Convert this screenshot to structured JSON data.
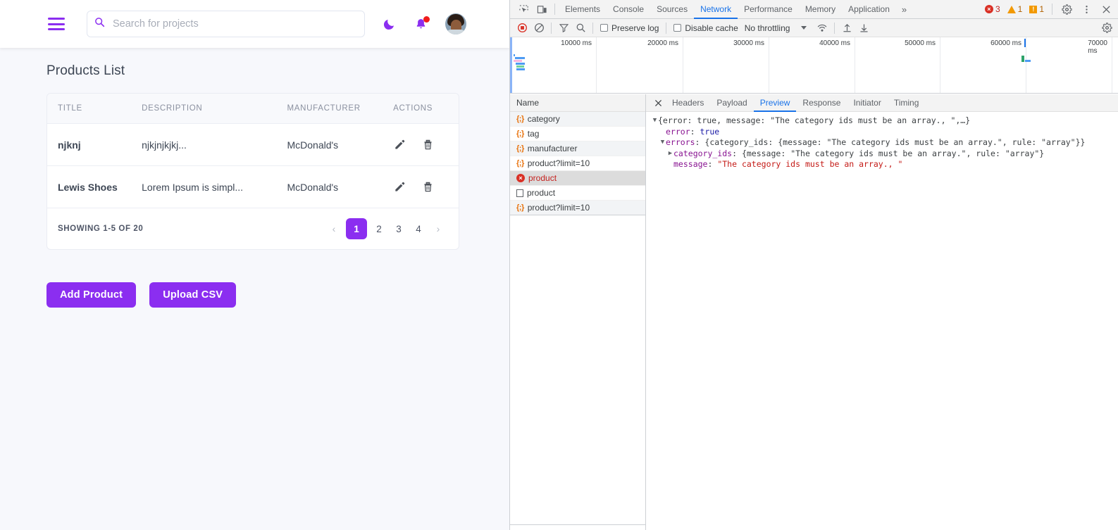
{
  "page": {
    "header": {
      "menu_icon": "hamburger-icon",
      "search": {
        "placeholder": "Search for projects",
        "value": "",
        "icon": "search-icon"
      },
      "theme_toggle_icon": "moon-icon",
      "notifications_icon": "bell-icon",
      "avatar_label": "user-avatar"
    },
    "title": "Products List",
    "table": {
      "columns": [
        "TITLE",
        "DESCRIPTION",
        "MANUFACTURER",
        "ACTIONS"
      ],
      "rows": [
        {
          "title": "njknj",
          "description": "njkjnjkjkj...",
          "manufacturer": "McDonald's",
          "edit_icon": "pencil-icon",
          "delete_icon": "trash-icon"
        },
        {
          "title": "Lewis Shoes",
          "description": "Lorem Ipsum is simpl...",
          "manufacturer": "McDonald's",
          "edit_icon": "pencil-icon",
          "delete_icon": "trash-icon"
        }
      ],
      "showing": "SHOWING 1-5 OF 20",
      "pagination": {
        "prev": "‹",
        "pages": [
          "1",
          "2",
          "3",
          "4"
        ],
        "active": "1",
        "next": "›"
      }
    },
    "buttons": {
      "add_product": "Add Product",
      "upload_csv": "Upload CSV"
    },
    "colors": {
      "accent": "#8b2ef0",
      "background": "#f7f8fc",
      "notification_dot": "#f01c1c"
    }
  },
  "devtools": {
    "tabs": [
      {
        "label": "Elements",
        "active": false
      },
      {
        "label": "Console",
        "active": false
      },
      {
        "label": "Sources",
        "active": false
      },
      {
        "label": "Network",
        "active": true
      },
      {
        "label": "Performance",
        "active": false
      },
      {
        "label": "Memory",
        "active": false
      },
      {
        "label": "Application",
        "active": false
      }
    ],
    "more_tabs": "»",
    "inspect_icon": "inspect-element-icon",
    "device_icon": "device-toolbar-icon",
    "counters": {
      "errors": "3",
      "warnings": "1",
      "infos": "1"
    },
    "settings_icon": "gear-icon",
    "kebab_icon": "more-options-icon",
    "close_icon": "close-icon",
    "network_toolbar": {
      "record_icon": "record-stop-icon",
      "clear_icon": "clear-icon",
      "filter_icon": "filter-icon",
      "search_icon": "search-icon",
      "preserve_log": {
        "label": "Preserve log",
        "checked": false
      },
      "disable_cache": {
        "label": "Disable cache",
        "checked": false
      },
      "throttling": "No throttling",
      "wifi_icon": "network-conditions-icon",
      "import_icon": "import-har-icon",
      "export_icon": "export-har-icon",
      "settings_icon": "network-settings-gear-icon"
    },
    "overview": {
      "ticks": [
        "10000 ms",
        "20000 ms",
        "30000 ms",
        "40000 ms",
        "50000 ms",
        "60000 ms",
        "70000 ms"
      ]
    },
    "requests": {
      "header": "Name",
      "items": [
        {
          "name": "category",
          "icon": "json-icon",
          "state": "normal"
        },
        {
          "name": "tag",
          "icon": "json-icon",
          "state": "normal"
        },
        {
          "name": "manufacturer",
          "icon": "json-icon",
          "state": "normal"
        },
        {
          "name": "product?limit=10",
          "icon": "json-icon",
          "state": "normal"
        },
        {
          "name": "product",
          "icon": "error-icon",
          "state": "selected-error"
        },
        {
          "name": "product",
          "icon": "document-icon",
          "state": "normal"
        },
        {
          "name": "product?limit=10",
          "icon": "json-icon",
          "state": "normal"
        }
      ]
    },
    "details": {
      "close_icon": "close-icon",
      "tabs": [
        {
          "label": "Headers",
          "active": false
        },
        {
          "label": "Payload",
          "active": false
        },
        {
          "label": "Preview",
          "active": true
        },
        {
          "label": "Response",
          "active": false
        },
        {
          "label": "Initiator",
          "active": false
        },
        {
          "label": "Timing",
          "active": false
        }
      ],
      "preview_lines": [
        {
          "twisty": "▼",
          "indent": 0,
          "parts": [
            {
              "t": "{error: ",
              "c": "punct"
            },
            {
              "t": "true",
              "c": "punct"
            },
            {
              "t": ", message: ",
              "c": "punct"
            },
            {
              "t": "\"The category ids must be an array., \"",
              "c": "punct"
            },
            {
              "t": ",…}",
              "c": "punct"
            }
          ]
        },
        {
          "twisty": "",
          "indent": 1,
          "parts": [
            {
              "t": "error",
              "c": "kk"
            },
            {
              "t": ": ",
              "c": "punct"
            },
            {
              "t": "true",
              "c": "v-bool"
            }
          ]
        },
        {
          "twisty": "▼",
          "indent": 1,
          "parts": [
            {
              "t": "errors",
              "c": "kk"
            },
            {
              "t": ": {category_ids: {message: ",
              "c": "punct"
            },
            {
              "t": "\"The category ids must be an array.\"",
              "c": "punct"
            },
            {
              "t": ", rule: ",
              "c": "punct"
            },
            {
              "t": "\"array\"",
              "c": "punct"
            },
            {
              "t": "}}",
              "c": "punct"
            }
          ]
        },
        {
          "twisty": "▶",
          "indent": 2,
          "parts": [
            {
              "t": "category_ids",
              "c": "kk"
            },
            {
              "t": ": {message: ",
              "c": "punct"
            },
            {
              "t": "\"The category ids must be an array.\"",
              "c": "punct"
            },
            {
              "t": ", rule: ",
              "c": "punct"
            },
            {
              "t": "\"array\"",
              "c": "punct"
            },
            {
              "t": "}",
              "c": "punct"
            }
          ]
        },
        {
          "twisty": "",
          "indent": 2,
          "parts": [
            {
              "t": "message",
              "c": "kk"
            },
            {
              "t": ": ",
              "c": "punct"
            },
            {
              "t": "\"The category ids must be an array., \"",
              "c": "v-str"
            }
          ]
        }
      ]
    }
  }
}
